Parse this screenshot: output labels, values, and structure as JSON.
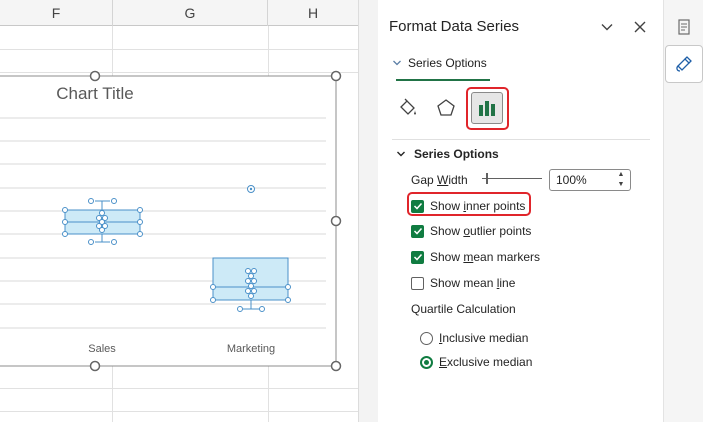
{
  "sheet": {
    "columns": [
      {
        "label": "F"
      },
      {
        "label": "G"
      },
      {
        "label": "H"
      }
    ]
  },
  "chart": {
    "title": "Chart Title",
    "categories": [
      "Sales",
      "Marketing"
    ]
  },
  "chart_data": {
    "type": "box",
    "title": "Chart Title",
    "categories": [
      "Sales",
      "Marketing"
    ],
    "series": [
      {
        "category": "Sales",
        "q1": 0.5,
        "median": 0.5,
        "q3": 0.5,
        "has_outlier": false
      },
      {
        "category": "Marketing",
        "has_outlier": true
      }
    ],
    "grid": true,
    "legend": "none",
    "box_fill": "#cdeaf7",
    "box_stroke": "#4a90c8"
  },
  "pane": {
    "title": "Format Data Series",
    "tab_label": "Series Options",
    "section_label": "Series Options",
    "gap_width_label_pre": "Gap ",
    "gap_width_label_u": "W",
    "gap_width_label_post": "idth",
    "gap_width_value": "100%",
    "checkboxes": [
      {
        "pre": "Show ",
        "u": "i",
        "post": "nner points",
        "checked": true
      },
      {
        "pre": "Show ",
        "u": "o",
        "post": "utlier points",
        "checked": true
      },
      {
        "pre": "Show ",
        "u": "m",
        "post": "ean markers",
        "checked": true
      },
      {
        "pre": "Show mean ",
        "u": "l",
        "post": "ine",
        "checked": false
      }
    ],
    "quartile_label": "Quartile Calculation",
    "radios": [
      {
        "u": "I",
        "post": "nclusive median",
        "selected": false
      },
      {
        "u": "E",
        "post": "xclusive median",
        "selected": true
      }
    ]
  },
  "icons": {
    "minimize": "chevron-down-icon",
    "close": "close-icon",
    "fill": "paint-bucket-icon",
    "effects": "pentagon-icon",
    "series_options": "bar-chart-icon",
    "rail_top": "document-icon",
    "rail_active": "paintbrush-icon"
  },
  "colors": {
    "accent_green": "#107c41",
    "highlight_red": "#e0252b",
    "box_fill": "#cdeaf7",
    "box_stroke": "#4a90c8"
  }
}
